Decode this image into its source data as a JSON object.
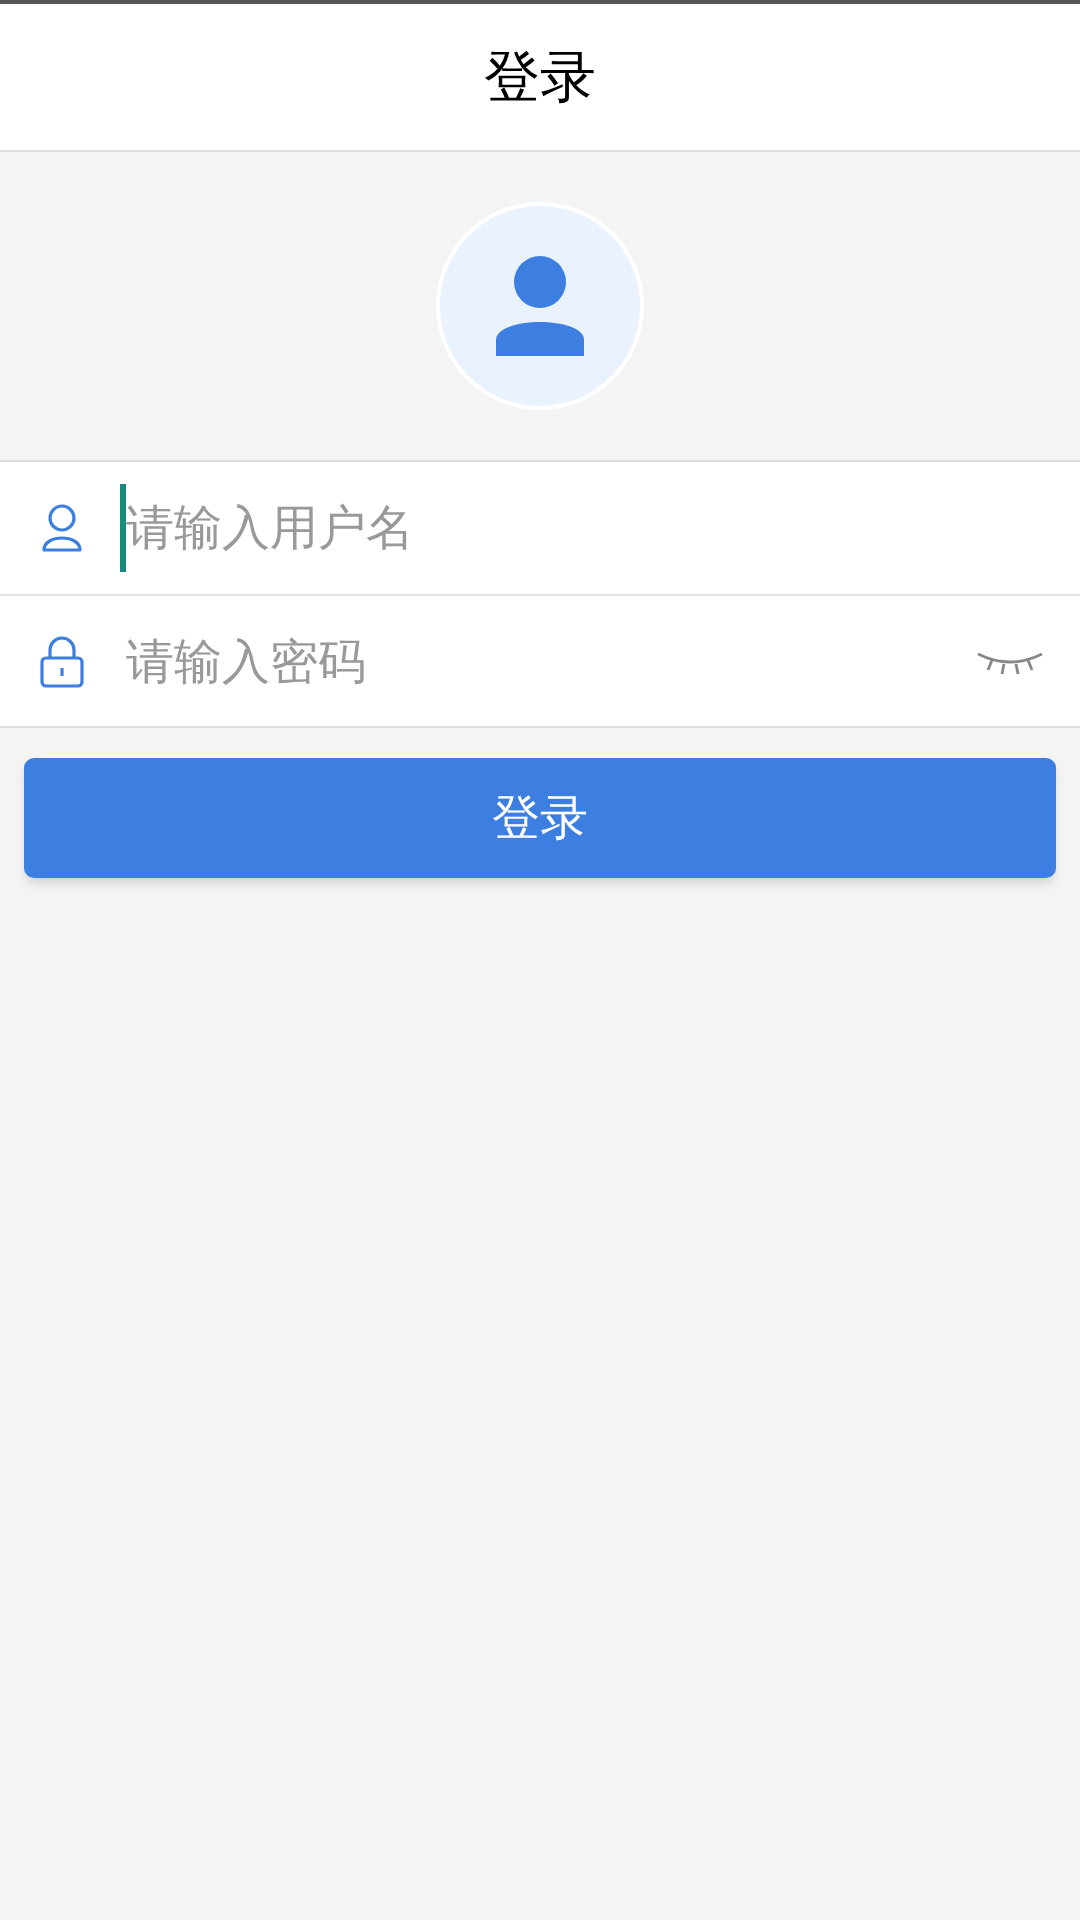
{
  "header": {
    "title": "登录"
  },
  "fields": [
    {
      "kind": "username",
      "placeholder": "请输入用户名",
      "focused": true
    },
    {
      "kind": "password",
      "placeholder": "请输入密码",
      "focused": false,
      "show_password": false
    }
  ],
  "login_button": {
    "label": "登录"
  }
}
